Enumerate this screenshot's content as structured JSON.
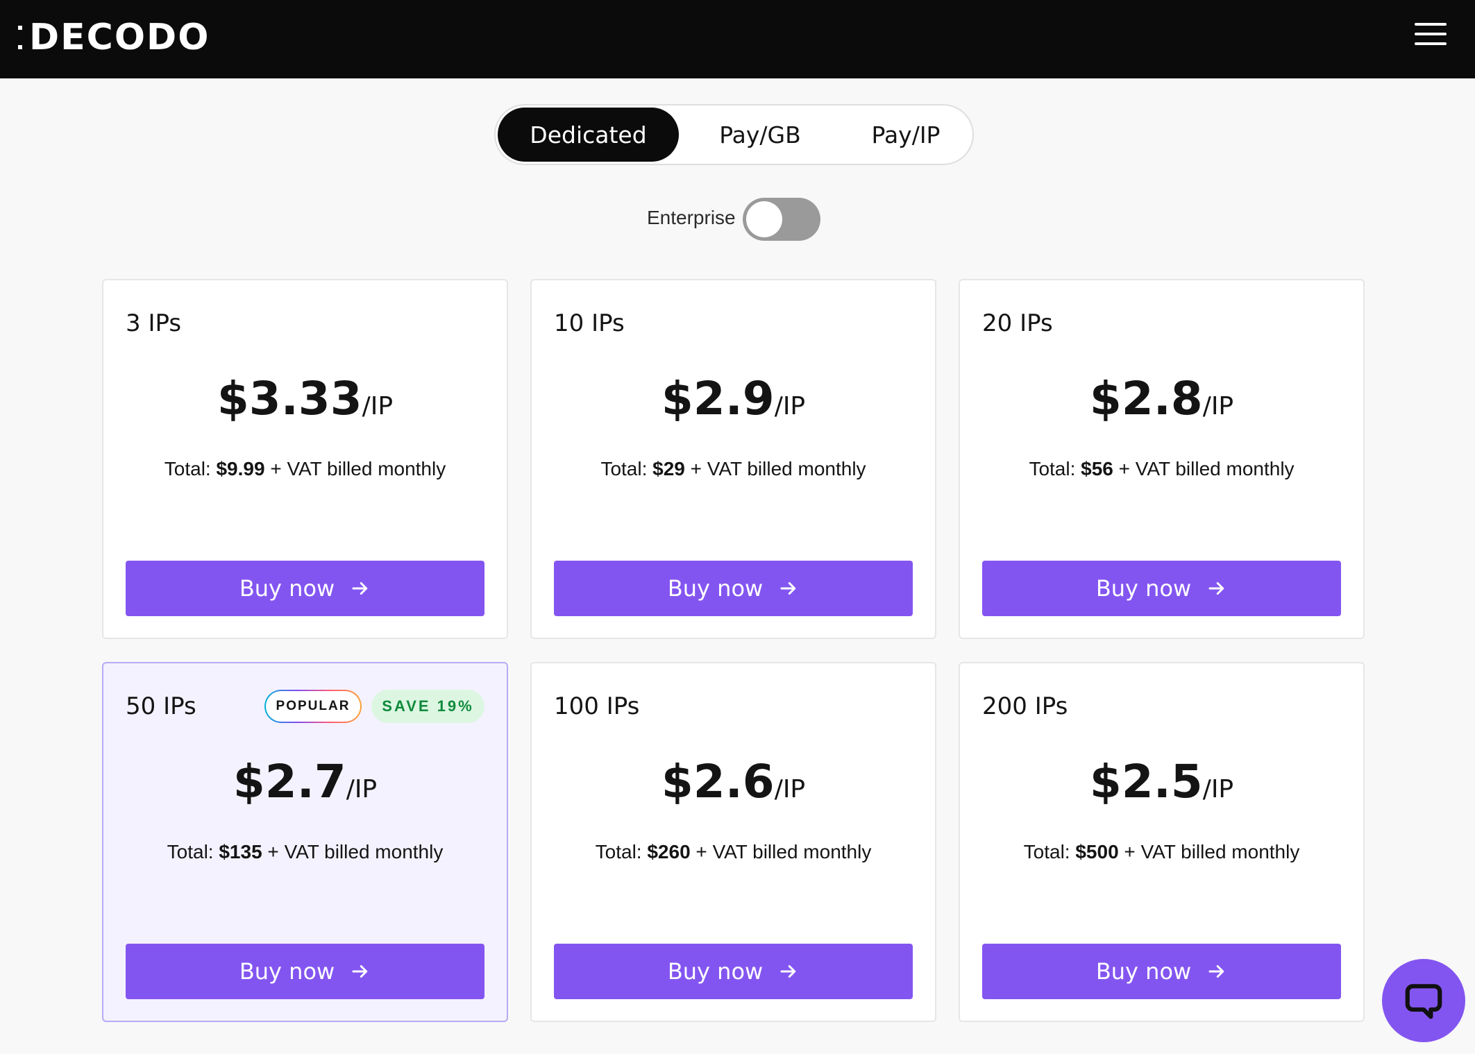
{
  "header": {
    "logo_text": "DECODO",
    "menu_icon": "hamburger-menu-icon"
  },
  "tabs": [
    {
      "label": "Dedicated",
      "active": true
    },
    {
      "label": "Pay/GB",
      "active": false
    },
    {
      "label": "Pay/IP",
      "active": false
    }
  ],
  "enterprise": {
    "label": "Enterprise",
    "enabled": false
  },
  "plans": [
    {
      "title": "3 IPs",
      "price": "$3.33",
      "unit": "/IP",
      "total_prefix": "Total: ",
      "total": "$9.99",
      "total_suffix": " + VAT billed monthly",
      "button": "Buy now"
    },
    {
      "title": "10 IPs",
      "price": "$2.9",
      "unit": "/IP",
      "total_prefix": "Total: ",
      "total": "$29",
      "total_suffix": " + VAT billed monthly",
      "button": "Buy now"
    },
    {
      "title": "20 IPs",
      "price": "$2.8",
      "unit": "/IP",
      "total_prefix": "Total: ",
      "total": "$56",
      "total_suffix": " + VAT billed monthly",
      "button": "Buy now"
    },
    {
      "title": "50 IPs",
      "price": "$2.7",
      "unit": "/IP",
      "total_prefix": "Total: ",
      "total": "$135",
      "total_suffix": " + VAT billed monthly",
      "button": "Buy now",
      "badge_popular": "POPULAR",
      "badge_save": "SAVE 19%"
    },
    {
      "title": "100 IPs",
      "price": "$2.6",
      "unit": "/IP",
      "total_prefix": "Total: ",
      "total": "$260",
      "total_suffix": " + VAT billed monthly",
      "button": "Buy now"
    },
    {
      "title": "200 IPs",
      "price": "$2.5",
      "unit": "/IP",
      "total_prefix": "Total: ",
      "total": "$500",
      "total_suffix": " + VAT billed monthly",
      "button": "Buy now"
    }
  ],
  "colors": {
    "accent": "#8355f0",
    "header_bg": "#0b0b0b",
    "featured_bg": "#f4f2fe",
    "save_badge_bg": "#dcf6e2",
    "save_badge_text": "#0f8a3b"
  },
  "chat": {
    "icon": "chat-bubble-icon"
  }
}
